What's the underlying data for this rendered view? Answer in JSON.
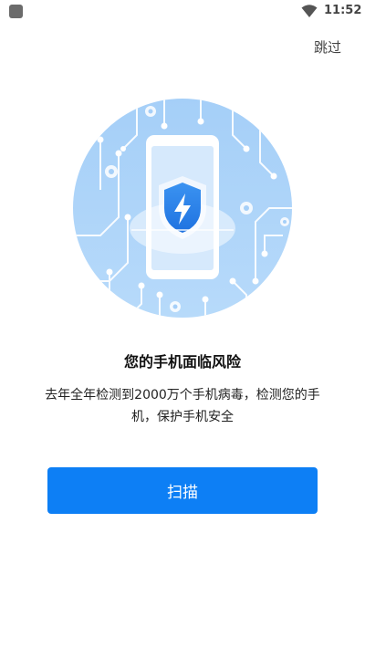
{
  "status_bar": {
    "time": "11:52"
  },
  "header": {
    "skip_label": "跳过"
  },
  "content": {
    "title": "您的手机面临风险",
    "description": "去年全年检测到2000万个手机病毒，检测您的手机，保护手机安全"
  },
  "actions": {
    "scan_label": "扫描"
  },
  "colors": {
    "accent": "#0d7ff5",
    "illustration_bg": "#a8d0f7"
  }
}
